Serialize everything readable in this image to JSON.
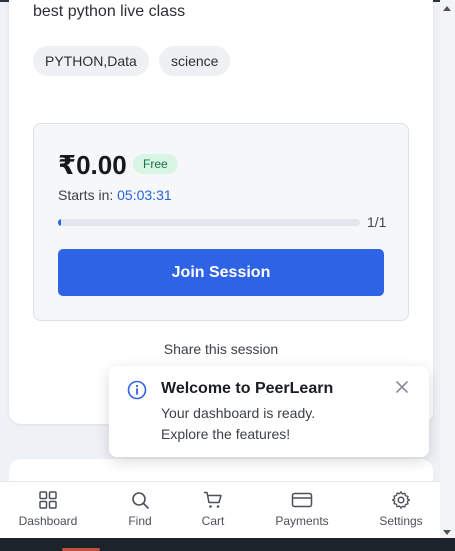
{
  "session": {
    "description": "best python live class",
    "tags": [
      "PYTHON,Data",
      "science"
    ],
    "price": "₹0.00",
    "price_badge": "Free",
    "starts_label": "Starts in:",
    "countdown": "05:03:31",
    "progress_fraction": 0.01,
    "progress_label": "1/1",
    "join_label": "Join Session",
    "share_label": "Share this session"
  },
  "toast": {
    "icon": "info-icon",
    "title": "Welcome to PeerLearn",
    "message": "Your dashboard is ready. Explore the features!"
  },
  "nav": {
    "items": [
      {
        "label": "Dashboard",
        "icon": "grid-icon"
      },
      {
        "label": "Find",
        "icon": "search-icon"
      },
      {
        "label": "Cart",
        "icon": "cart-icon"
      },
      {
        "label": "Payments",
        "icon": "card-icon"
      },
      {
        "label": "Settings",
        "icon": "gear-icon"
      }
    ]
  },
  "colors": {
    "accent": "#2f63e6",
    "free_badge_bg": "#d9f5e3",
    "free_badge_text": "#177245",
    "countdown": "#2563d9",
    "page_bg": "#eef1f5"
  }
}
